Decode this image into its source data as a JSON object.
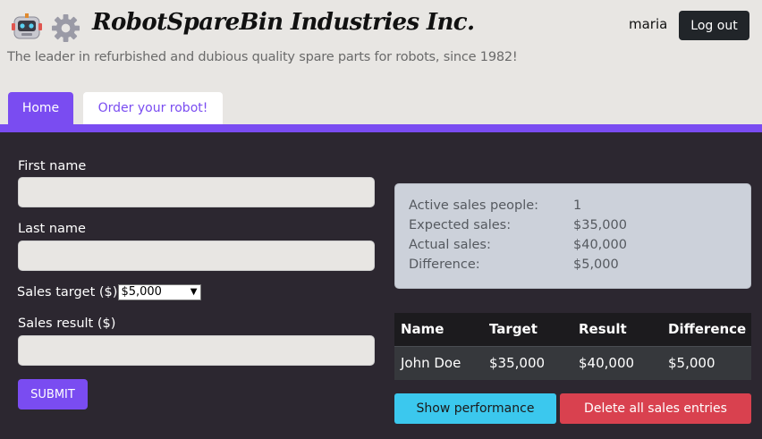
{
  "header": {
    "brand": "RobotSpareBin Industries Inc.",
    "tagline": "The leader in refurbished and dubious quality spare parts for robots, since 1982!",
    "username": "maria",
    "logout_label": "Log out",
    "logo_icon": "robot-icon",
    "gear_icon": "gear-icon"
  },
  "tabs": [
    {
      "label": "Home",
      "active": true
    },
    {
      "label": "Order your robot!",
      "active": false
    }
  ],
  "form": {
    "first_name_label": "First name",
    "first_name_value": "",
    "last_name_label": "Last name",
    "last_name_value": "",
    "sales_target_label": "Sales target ($)",
    "sales_target_selected": "$5,000",
    "sales_result_label": "Sales result ($)",
    "sales_result_value": "",
    "submit_label": "SUBMIT"
  },
  "stats": [
    {
      "label": "Active sales people:",
      "value": "1"
    },
    {
      "label": "Expected sales:",
      "value": "$35,000"
    },
    {
      "label": "Actual sales:",
      "value": "$40,000"
    },
    {
      "label": "Difference:",
      "value": "$5,000"
    }
  ],
  "table": {
    "headers": [
      "Name",
      "Target",
      "Result",
      "Difference"
    ],
    "rows": [
      [
        "John Doe",
        "$35,000",
        "$40,000",
        "$5,000"
      ]
    ]
  },
  "actions": {
    "show_performance_label": "Show performance",
    "delete_all_label": "Delete all sales entries"
  },
  "colors": {
    "accent": "#7a4cf1",
    "header_bg": "#e8e6e3",
    "page_bg": "#2c2730",
    "info": "#3bc8ee",
    "danger": "#d9414f"
  }
}
